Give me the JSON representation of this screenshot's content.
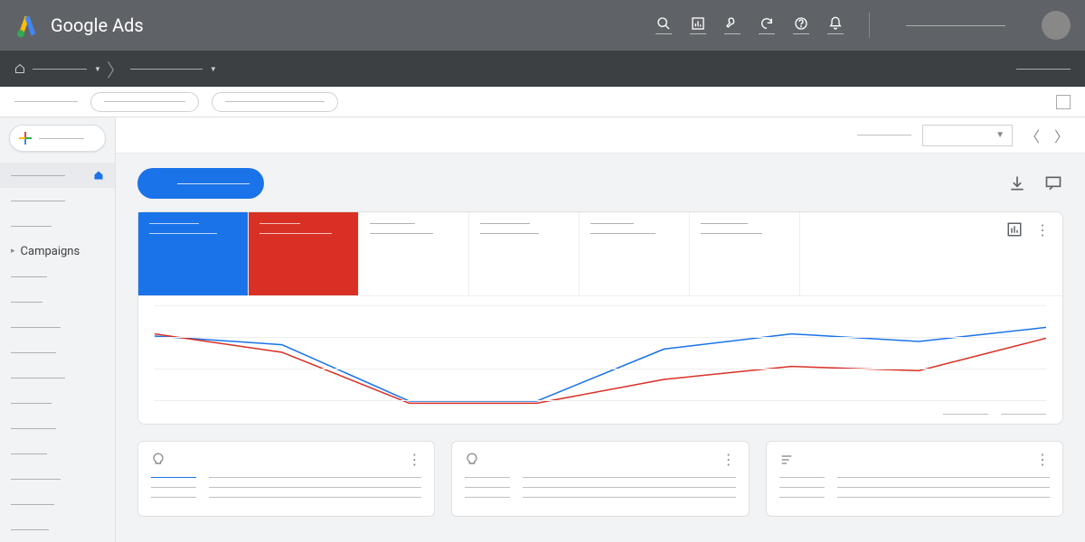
{
  "header": {
    "product": "Google Ads",
    "icons": [
      "search",
      "reports",
      "tools",
      "refresh",
      "help",
      "notifications"
    ]
  },
  "breadcrumb": {
    "items": [
      "",
      ""
    ]
  },
  "sidebar": {
    "new_label": "",
    "items": [
      {
        "label": "",
        "active": true,
        "icon": "home"
      },
      {
        "label": ""
      },
      {
        "label": ""
      },
      {
        "label": "Campaigns",
        "expandable": true
      },
      {
        "label": ""
      },
      {
        "label": ""
      },
      {
        "label": ""
      },
      {
        "label": ""
      },
      {
        "label": ""
      },
      {
        "label": ""
      },
      {
        "label": ""
      },
      {
        "label": ""
      },
      {
        "label": ""
      },
      {
        "label": ""
      },
      {
        "label": ""
      }
    ]
  },
  "filterbar": {
    "date_range": " ",
    "date_dropdown_icon": "▼"
  },
  "overview": {
    "new_campaign": "",
    "metrics": [
      {
        "label": "",
        "value": "",
        "color": "blue"
      },
      {
        "label": "",
        "value": "",
        "color": "red"
      },
      {
        "label": "",
        "value": ""
      },
      {
        "label": "",
        "value": ""
      },
      {
        "label": "",
        "value": ""
      },
      {
        "label": "",
        "value": ""
      }
    ]
  },
  "chart_data": {
    "type": "line",
    "title": "",
    "xlabel": "",
    "ylabel": "",
    "x": [
      0,
      1,
      2,
      3,
      4,
      5,
      6
    ],
    "series": [
      {
        "name": "metric-blue",
        "color": "#1a73e8",
        "values": [
          70,
          62,
          10,
          10,
          58,
          72,
          65,
          78
        ]
      },
      {
        "name": "metric-red",
        "color": "#d93025",
        "values": [
          72,
          55,
          8,
          8,
          30,
          42,
          38,
          68
        ]
      }
    ],
    "ylim": [
      0,
      100
    ]
  },
  "recommendations": [
    {
      "icon": "lightbulb",
      "rows": [
        [
          "",
          ""
        ],
        [
          "",
          ""
        ],
        [
          "",
          ""
        ]
      ],
      "highlight_first": true
    },
    {
      "icon": "lightbulb",
      "rows": [
        [
          "",
          ""
        ],
        [
          "",
          ""
        ],
        [
          "",
          ""
        ]
      ]
    },
    {
      "icon": "text",
      "rows": [
        [
          "",
          ""
        ],
        [
          "",
          ""
        ],
        [
          "",
          ""
        ]
      ]
    }
  ]
}
